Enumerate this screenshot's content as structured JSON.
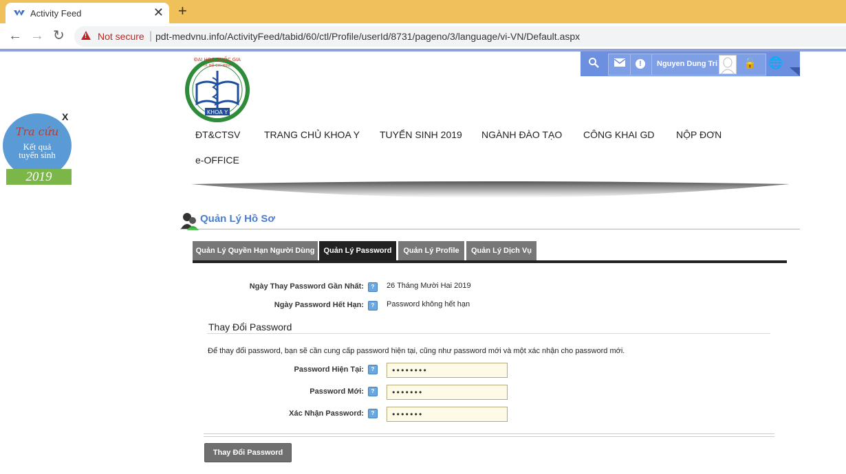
{
  "browser": {
    "tab_title": "Activity Feed",
    "close_glyph": "✕",
    "new_tab_glyph": "+",
    "back_glyph": "←",
    "forward_glyph": "→",
    "reload_glyph": "↻",
    "security_label": "Not secure",
    "url": "pdt-medvnu.info/ActivityFeed/tabid/60/ctl/Profile/userId/8731/pageno/3/language/vi-VN/Default.aspx"
  },
  "ad": {
    "close_label": "X",
    "line1": "Tra cứu",
    "line2": "Kết quả",
    "line3": "tuyển sinh",
    "year": "2019"
  },
  "userbar": {
    "user_name": "Nguyen Dung Tri",
    "search_icon": "search-icon",
    "mail_icon": "mail-icon",
    "alert_glyph": "!",
    "lock_glyph": "🔓",
    "globe_glyph": "🌐"
  },
  "logo": {
    "top_text": "ĐẠI HỌC QUỐC GIA",
    "sub_text": "TP. HỒ CHÍ MINH",
    "bottom_text": "KHOA Y"
  },
  "nav": {
    "items": [
      "ĐT&CTSV",
      "TRANG CHỦ KHOA Y",
      "TUYỂN SINH 2019",
      "NGÀNH ĐÀO TẠO",
      "CÔNG KHAI GD",
      "NỘP ĐƠN",
      "e-OFFICE"
    ]
  },
  "module": {
    "title": "Quản Lý Hồ Sơ"
  },
  "tabs": [
    {
      "label": "Quản Lý Quyền Hạn Người Dùng"
    },
    {
      "label": "Quản Lý Password"
    },
    {
      "label": "Quản Lý Profile"
    },
    {
      "label": "Quản Lý Dịch Vụ"
    }
  ],
  "active_tab": "Quản Lý Password",
  "info": {
    "last_changed_label": "Ngày Thay Password Gần Nhất:",
    "last_changed_value": "26 Tháng Mười Hai 2019",
    "expires_label": "Ngày Password Hết Hạn:",
    "expires_value": "Password không hết hạn"
  },
  "change_password": {
    "section_title": "Thay Đổi Password",
    "description": "Để thay đổi password, bạn sẽ cần cung cấp password hiện tại, cũng như password mới và một xác nhận cho password mới.",
    "current_label": "Password Hiện Tại:",
    "current_value": "••••••••",
    "new_label": "Password Mới:",
    "new_value": "•••••••",
    "confirm_label": "Xác Nhận Password:",
    "confirm_value": "•••••••",
    "help_glyph": "?",
    "submit_label": "Thay Đổi Password"
  }
}
